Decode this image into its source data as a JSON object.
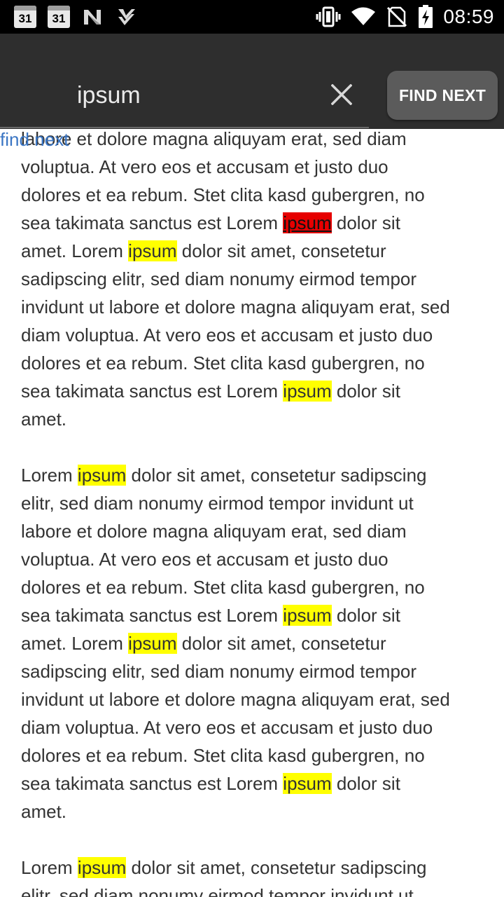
{
  "status_bar": {
    "time": "08:59",
    "calendar_day_1": "31",
    "calendar_day_2": "31",
    "icons": [
      "calendar-icon",
      "calendar-icon",
      "n-app-icon",
      "check-app-icon",
      "vibrate-icon",
      "wifi-icon",
      "no-sim-icon",
      "battery-charging-icon"
    ]
  },
  "find_toolbar": {
    "query": "ipsum",
    "find_next_label": "FIND NEXT",
    "clear_icon": "close-icon"
  },
  "find_next_link": "find next",
  "colors": {
    "match_highlight": "#ffff00",
    "current_match_highlight": "#e60000",
    "toolbar_background": "#2e2e2e",
    "button_background": "#5b5b5b",
    "link_color": "#3b76c4"
  },
  "content": {
    "lines": [
      [
        {
          "t": "labore et dolore magna aliquyam erat, sed diam"
        }
      ],
      [
        {
          "t": "voluptua. At vero eos et accusam et justo duo"
        }
      ],
      [
        {
          "t": "dolores et ea rebum. Stet clita kasd gubergren, no"
        }
      ],
      [
        {
          "t": "sea takimata sanctus est Lorem "
        },
        {
          "t": "ipsum",
          "h": "current"
        },
        {
          "t": " dolor sit"
        }
      ],
      [
        {
          "t": "amet. Lorem "
        },
        {
          "t": "ipsum",
          "h": "match"
        },
        {
          "t": " dolor sit amet, consetetur"
        }
      ],
      [
        {
          "t": "sadipscing elitr, sed diam nonumy eirmod tempor"
        }
      ],
      [
        {
          "t": "invidunt ut labore et dolore magna aliquyam erat, sed"
        }
      ],
      [
        {
          "t": "diam voluptua. At vero eos et accusam et justo duo"
        }
      ],
      [
        {
          "t": "dolores et ea rebum. Stet clita kasd gubergren, no"
        }
      ],
      [
        {
          "t": "sea takimata sanctus est Lorem "
        },
        {
          "t": "ipsum",
          "h": "match"
        },
        {
          "t": " dolor sit"
        }
      ],
      [
        {
          "t": "amet."
        }
      ],
      [],
      [
        {
          "t": "Lorem "
        },
        {
          "t": "ipsum",
          "h": "match"
        },
        {
          "t": " dolor sit amet, consetetur sadipscing"
        }
      ],
      [
        {
          "t": "elitr, sed diam nonumy eirmod tempor invidunt ut"
        }
      ],
      [
        {
          "t": "labore et dolore magna aliquyam erat, sed diam"
        }
      ],
      [
        {
          "t": "voluptua. At vero eos et accusam et justo duo"
        }
      ],
      [
        {
          "t": "dolores et ea rebum. Stet clita kasd gubergren, no"
        }
      ],
      [
        {
          "t": "sea takimata sanctus est Lorem "
        },
        {
          "t": "ipsum",
          "h": "match"
        },
        {
          "t": " dolor sit"
        }
      ],
      [
        {
          "t": "amet. Lorem "
        },
        {
          "t": "ipsum",
          "h": "match"
        },
        {
          "t": " dolor sit amet, consetetur"
        }
      ],
      [
        {
          "t": "sadipscing elitr, sed diam nonumy eirmod tempor"
        }
      ],
      [
        {
          "t": "invidunt ut labore et dolore magna aliquyam erat, sed"
        }
      ],
      [
        {
          "t": "diam voluptua. At vero eos et accusam et justo duo"
        }
      ],
      [
        {
          "t": "dolores et ea rebum. Stet clita kasd gubergren, no"
        }
      ],
      [
        {
          "t": "sea takimata sanctus est Lorem "
        },
        {
          "t": "ipsum",
          "h": "match"
        },
        {
          "t": " dolor sit"
        }
      ],
      [
        {
          "t": "amet."
        }
      ],
      [],
      [
        {
          "t": "Lorem "
        },
        {
          "t": "ipsum",
          "h": "match"
        },
        {
          "t": " dolor sit amet, consetetur sadipscing"
        }
      ],
      [
        {
          "t": "elitr, sed diam nonumy eirmod tempor invidunt ut"
        }
      ]
    ]
  }
}
